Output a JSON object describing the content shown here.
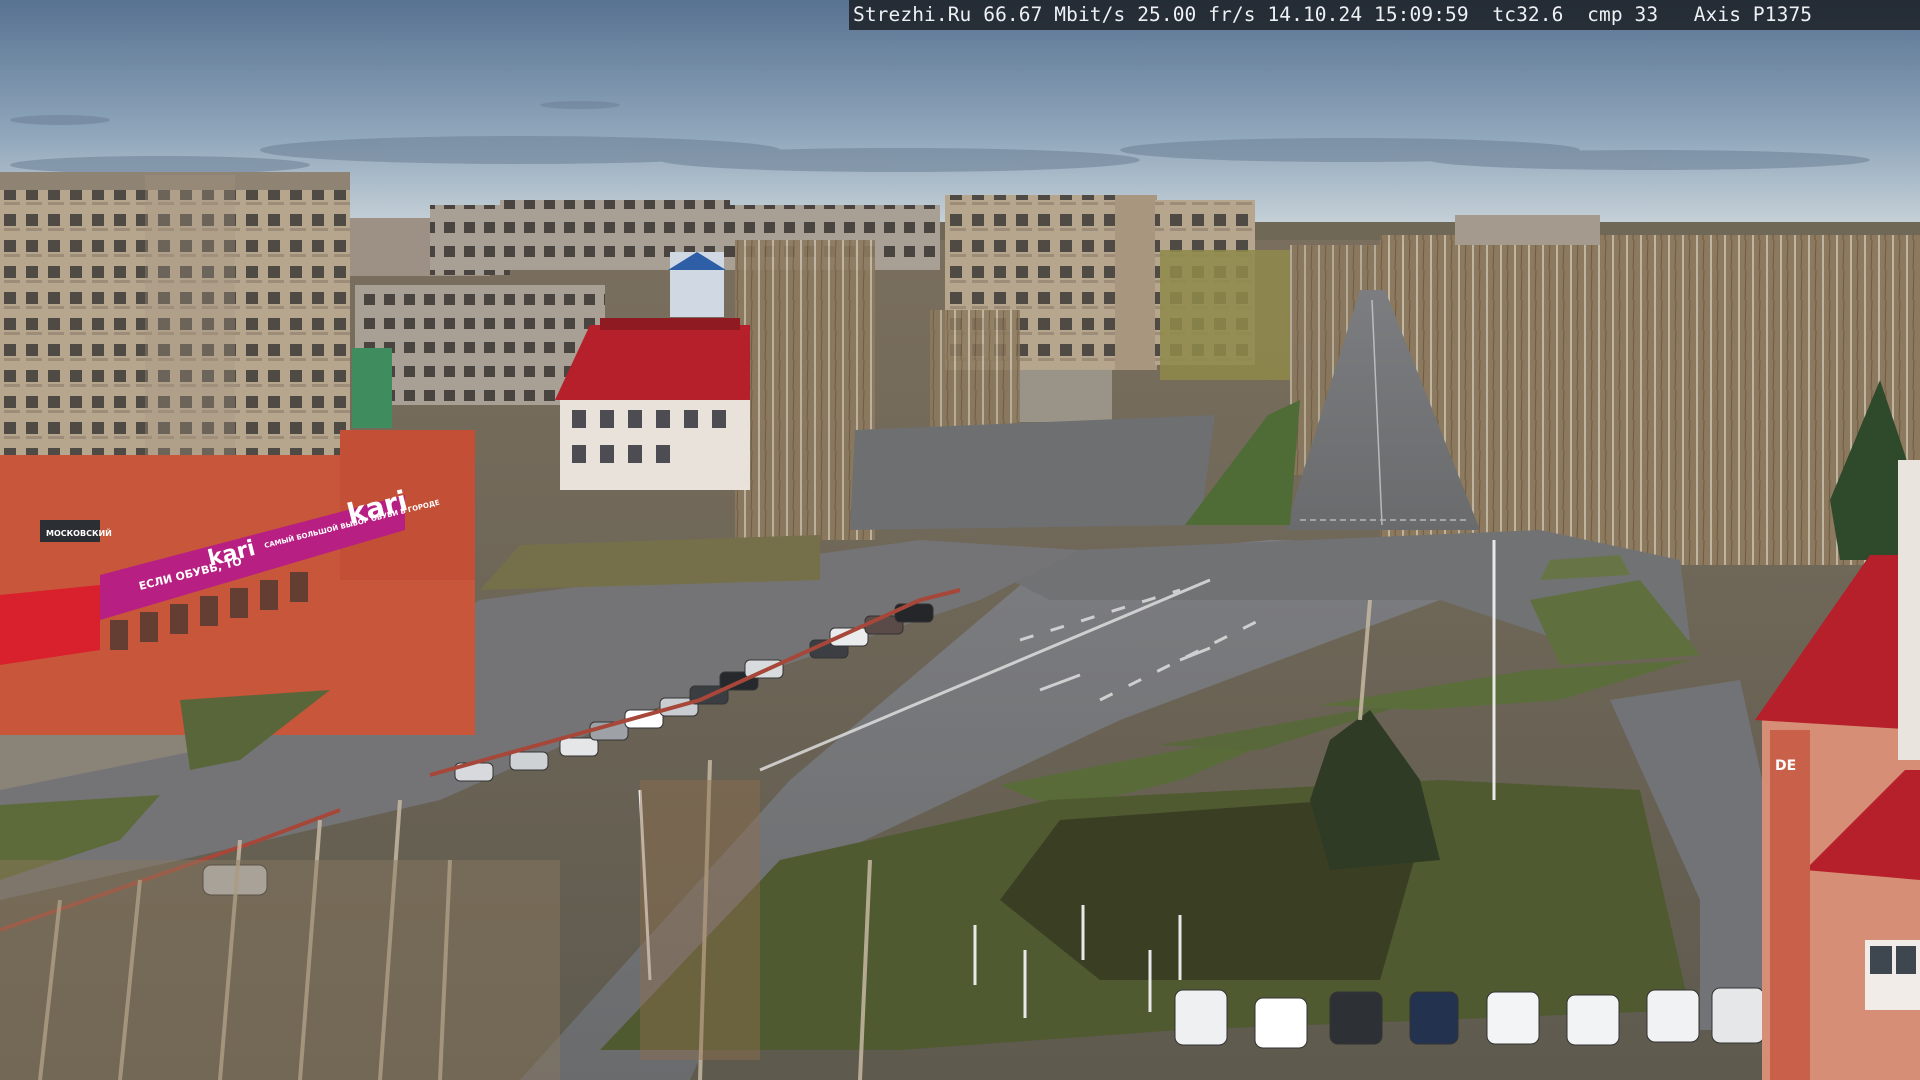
{
  "overlay": {
    "site": "Strezhi.Ru",
    "bitrate": "66.67 Mbit/s",
    "framerate": "25.00 fr/s",
    "datetime": "14.10.24 15:09:59",
    "tc": "tc32.6",
    "cmp": "cmp 33",
    "camera": "Axis P1375"
  },
  "signs": {
    "store_logo": "kari",
    "store_logo_small": "kari",
    "store_slogan": "ЕСЛИ ОБУВЬ, ТО",
    "store_sub": "САМЫЙ БОЛЬШОЙ ВЫБОР ОБУВИ В ГОРОДЕ",
    "building_sign": "МОСКОВСКИЙ",
    "right_building_sign": "DE"
  },
  "colors": {
    "sky_top": "#5e7690",
    "sky_horizon": "#c9d3da",
    "asphalt": "#6d6e70",
    "grass": "#5d6a3a",
    "brick": "#c8563a",
    "magenta_band": "#b81f83",
    "red_roof": "#b5202a",
    "panel_building": "#b8a68e"
  }
}
